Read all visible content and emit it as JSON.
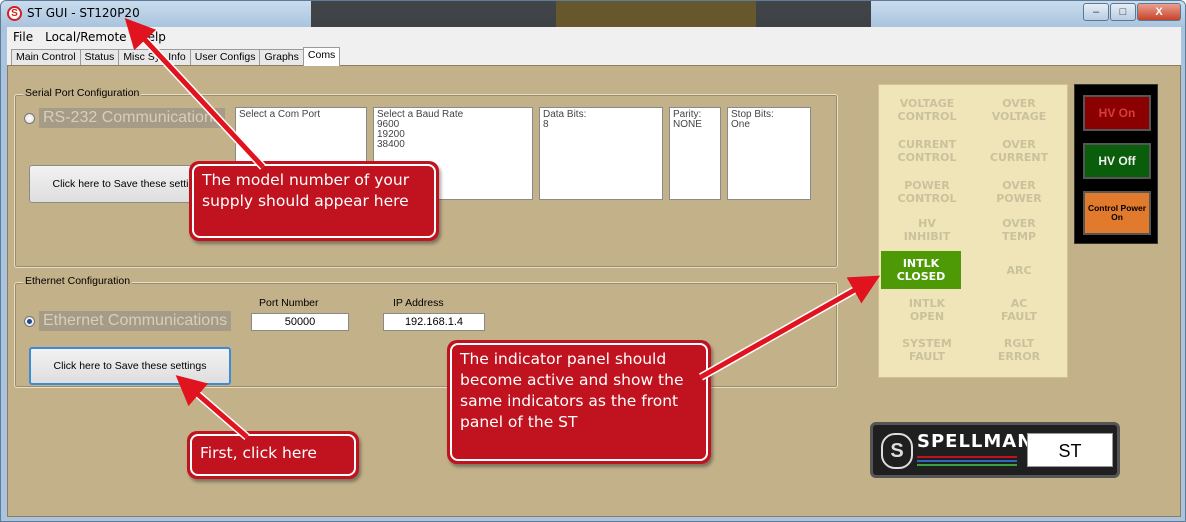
{
  "window": {
    "title": "ST GUI - ST120P20",
    "app_icon": "spellman-logo-icon",
    "controls": {
      "minimize": "–",
      "maximize": "□",
      "close": "X"
    }
  },
  "menu": [
    "File",
    "Local/Remote",
    "Help"
  ],
  "tabs": [
    {
      "label": "Main Control",
      "active": false
    },
    {
      "label": "Status",
      "active": false
    },
    {
      "label": "Misc Sys Info",
      "active": false
    },
    {
      "label": "User Configs",
      "active": false
    },
    {
      "label": "Graphs",
      "active": false
    },
    {
      "label": "Coms",
      "active": true
    }
  ],
  "serial": {
    "legend": "Serial Port Configuration",
    "radio_label": "RS-232 Communications",
    "com_port": {
      "header": "Select a Com Port"
    },
    "baud": {
      "header": "Select a Baud Rate",
      "options": [
        "9600",
        "19200",
        "38400"
      ]
    },
    "data_bits": {
      "header": "Data Bits:",
      "value": "8"
    },
    "parity": {
      "header": "Parity:",
      "value": "NONE"
    },
    "stop_bits": {
      "header": "Stop Bits:",
      "value": "One"
    },
    "save_button": "Click here to Save these settings"
  },
  "ethernet": {
    "legend": "Ethernet Configuration",
    "radio_label": "Ethernet Communications",
    "selected": true,
    "port_label": "Port Number",
    "port_value": "50000",
    "ip_label": "IP Address",
    "ip_value": "192.168.1.4",
    "save_button": "Click here to Save these settings"
  },
  "indicators": [
    {
      "label": "VOLTAGE\nCONTROL",
      "active": false
    },
    {
      "label": "OVER\nVOLTAGE",
      "active": false
    },
    {
      "label": "CURRENT\nCONTROL",
      "active": false
    },
    {
      "label": "OVER\nCURRENT",
      "active": false
    },
    {
      "label": "POWER\nCONTROL",
      "active": false
    },
    {
      "label": "OVER\nPOWER",
      "active": false
    },
    {
      "label": "HV\nINHIBIT",
      "active": false
    },
    {
      "label": "OVER\nTEMP",
      "active": false
    },
    {
      "label": "INTLK\nCLOSED",
      "active": true
    },
    {
      "label": "ARC",
      "active": false
    },
    {
      "label": "INTLK\nOPEN",
      "active": false
    },
    {
      "label": "AC\nFAULT",
      "active": false
    },
    {
      "label": "SYSTEM\nFAULT",
      "active": false
    },
    {
      "label": "RGLT\nERROR",
      "active": false
    }
  ],
  "hv_panel": {
    "hv_on": "HV On",
    "hv_off": "HV Off",
    "control_power": "Control Power On"
  },
  "logo": {
    "brand": "SPELLMAN",
    "model": "ST"
  },
  "callouts": {
    "model": "The model number of your supply should appear here",
    "indicator": "The indicator panel should become active and show the same indicators as the front panel of the ST",
    "first": "First, click here"
  },
  "colors": {
    "client_bg": "#c3b18a",
    "indicator_active": "#4e9a06",
    "callout_red": "#c1121f",
    "hv_on": "#8b0000",
    "hv_off": "#0a5d0a",
    "control_power": "#e27a2e"
  }
}
